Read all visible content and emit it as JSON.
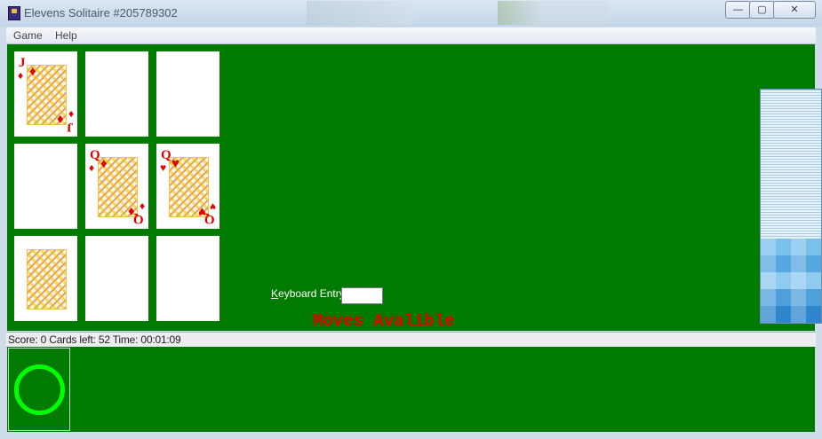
{
  "window": {
    "title": "Elevens Solitaire #205789302",
    "controls": {
      "minimize": "—",
      "maximize": "▢",
      "close": "✕"
    }
  },
  "menu": {
    "items": [
      "Game",
      "Help"
    ]
  },
  "tableau": {
    "rows": [
      [
        {
          "rank": "J",
          "suit": "♦",
          "face": true
        },
        null,
        null
      ],
      [
        null,
        {
          "rank": "Q",
          "suit": "♦",
          "face": true
        },
        {
          "rank": "Q",
          "suit": "♥",
          "face": true
        }
      ],
      [
        {
          "rank": "",
          "suit": "",
          "face": true
        },
        null,
        null
      ]
    ]
  },
  "keyboard_entry": {
    "label": "Keyboard Entry:",
    "value": ""
  },
  "message": "Moves Avalible",
  "status": {
    "text": "Score: 0  Cards left: 52  Time: 00:01:09"
  },
  "indicator": {
    "icon": "green-ring-icon",
    "color": "#00ff00"
  },
  "colors": {
    "table": "#007b00",
    "card_red": "#e00000",
    "message": "#e80000"
  }
}
